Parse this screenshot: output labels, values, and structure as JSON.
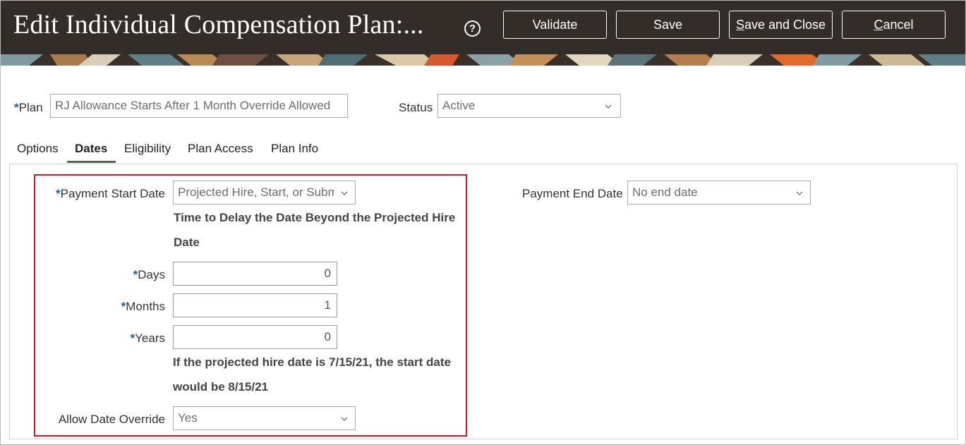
{
  "header": {
    "title": "Edit Individual Compensation Plan:...",
    "help_icon": "question-circle-icon",
    "buttons": {
      "validate": "Validate",
      "save": "Save",
      "save_and_close_u": "S",
      "save_and_close_rest": "ave and Close",
      "cancel_u": "C",
      "cancel_rest": "ancel"
    }
  },
  "plan": {
    "label": "Plan",
    "value": "RJ Allowance Starts After 1 Month Override Allowed"
  },
  "status": {
    "label": "Status",
    "value": "Active"
  },
  "tabs": [
    {
      "label": "Options",
      "active": false
    },
    {
      "label": "Dates",
      "active": true
    },
    {
      "label": "Eligibility",
      "active": false
    },
    {
      "label": "Plan Access",
      "active": false
    },
    {
      "label": "Plan Info",
      "active": false
    }
  ],
  "dates": {
    "payment_start_date": {
      "label": "Payment Start Date",
      "value": "Projected Hire, Start, or Subm"
    },
    "delay_heading_line1": "Time to Delay the Date Beyond the Projected Hire",
    "delay_heading_line2": "Date",
    "days": {
      "label": "Days",
      "value": "0"
    },
    "months": {
      "label": "Months",
      "value": "1"
    },
    "years": {
      "label": "Years",
      "value": "0"
    },
    "example_line1": "If the projected hire date is 7/15/21, the start date",
    "example_line2": "would be 8/15/21",
    "allow_override": {
      "label": "Allow Date Override",
      "value": "Yes"
    },
    "payment_end_date": {
      "label": "Payment End Date",
      "value": "No end date"
    }
  },
  "colors": {
    "header_bg": "#322d29",
    "required_marker": "#1a5faa",
    "highlight_border": "#e0141c",
    "active_tab_underline": "#4a6a50"
  }
}
